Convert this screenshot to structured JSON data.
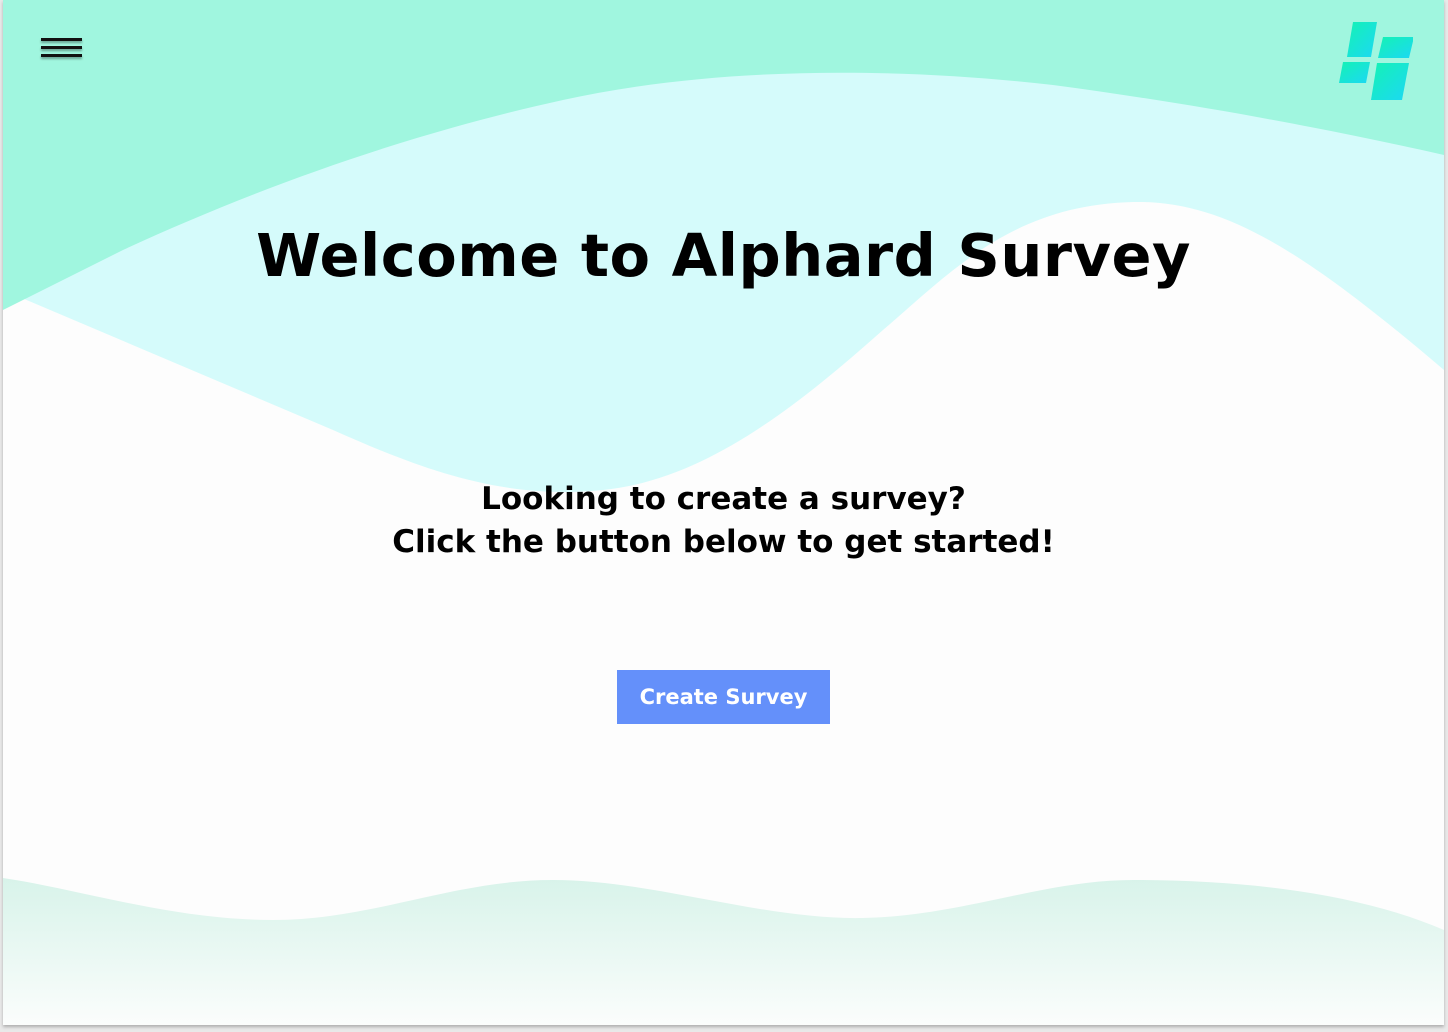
{
  "menu": {
    "icon": "hamburger-menu-icon"
  },
  "logo": {
    "icon": "alphard-logo-icon",
    "colors": [
      "#17f0b9",
      "#1ce0f0"
    ]
  },
  "hero": {
    "title": "Welcome to Alphard Survey",
    "tagline_line1": "Looking to create a survey?",
    "tagline_line2": "Click the button below to get started!"
  },
  "actions": {
    "create_label": "Create Survey"
  },
  "colors": {
    "wave_top": "#a0f6df",
    "wave_light": "#d5fbfb",
    "wave_bottom": "#dcf3ea",
    "button": "#6490fa",
    "background": "#fdfdfd"
  }
}
